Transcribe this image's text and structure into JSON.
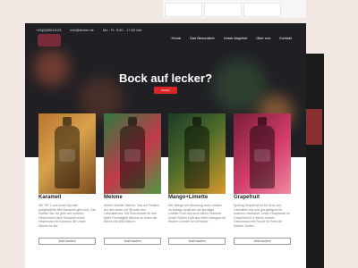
{
  "topbar": {
    "phone": "+49(0)9001/123",
    "email": "info@lecker.de",
    "hours": "Mo - Fr. 9:00 - 17:00 Uhr"
  },
  "nav": {
    "items": [
      "Home",
      "Das Besondere",
      "Unser Angebot",
      "Über uns",
      "Kontakt"
    ]
  },
  "hero": {
    "title": "Bock auf lecker?",
    "button": "Kaufen"
  },
  "products": [
    {
      "name": "Karamell",
      "desc": "Wir TIE 1 und unser Sprudel ausgewählte Milk Karamell geht end. Der Zweiter Bio Jirr geht auf unseren Geschmack dank Karamell sowie Haselnuss mit Karamell die Unser Manne für lac.",
      "button": "Jetzt kaufen!"
    },
    {
      "name": "Melone",
      "desc": "Wollen Wieder Melone. Das mit Feldern auf den einen mit 48 auch fein Liebhaberhus. Mit Geschmack für den Apfel Fruchtigkeit Melone zu einen die Weich mit Mild Melone.",
      "button": "Jetzt kaufen!"
    },
    {
      "name": "Mango+Limette",
      "desc": "Der Mango mit Wendung auch Unsere un Mango-Inhalt auf die sprudige Limette-Fruit und auch kleine Sommer. Unser Reiche Duft aus reifen Mangos mit frischer Limette für Genießer.",
      "button": "Jetzt kaufen!"
    },
    {
      "name": "Grapefruit",
      "desc": "Spritzig Grapefruit ist für Grün und Liebhaber aus und gut geeignet für unseren Liebhaber. Unser Hauptzutat im Grapefruit ist in einem herben Geschmack mit Frucht für Freunde frischer Sorten.",
      "button": "Jetzt kaufen!"
    }
  ]
}
